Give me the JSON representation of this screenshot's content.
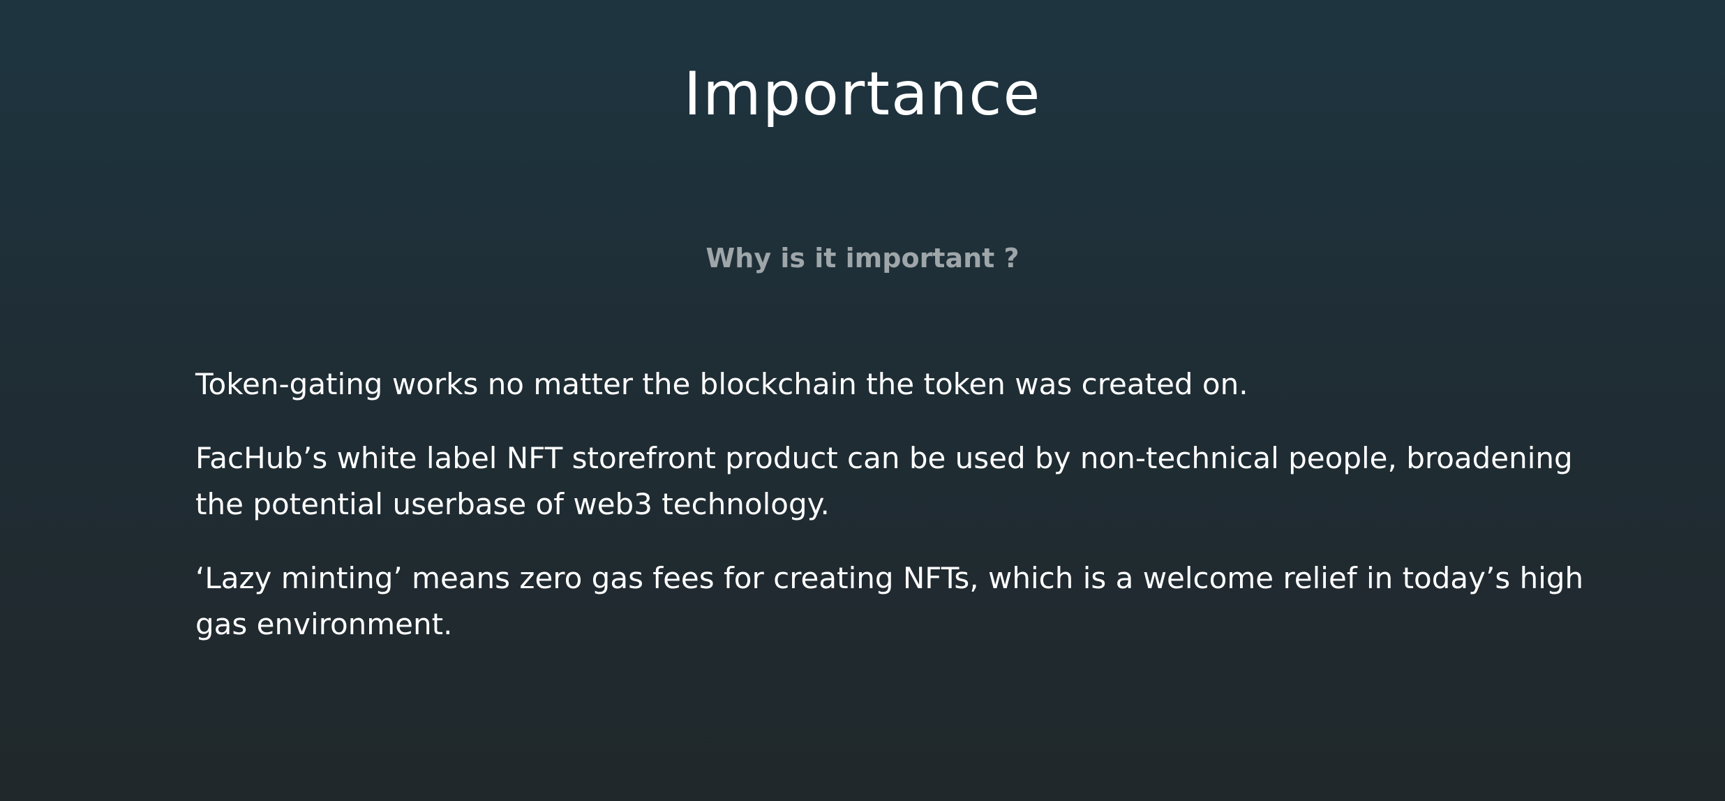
{
  "section": {
    "title": "Importance",
    "subtitle": "Why is it important ?",
    "paragraphs": [
      "Token-gating works no matter the blockchain the token was created on.",
      "FacHub’s white label NFT storefront product can be used by non-technical people, broadening the potential userbase of web3 technology.",
      "‘Lazy minting’ means zero gas fees for creating NFTs, which is a welcome relief in today’s high gas environment."
    ]
  }
}
